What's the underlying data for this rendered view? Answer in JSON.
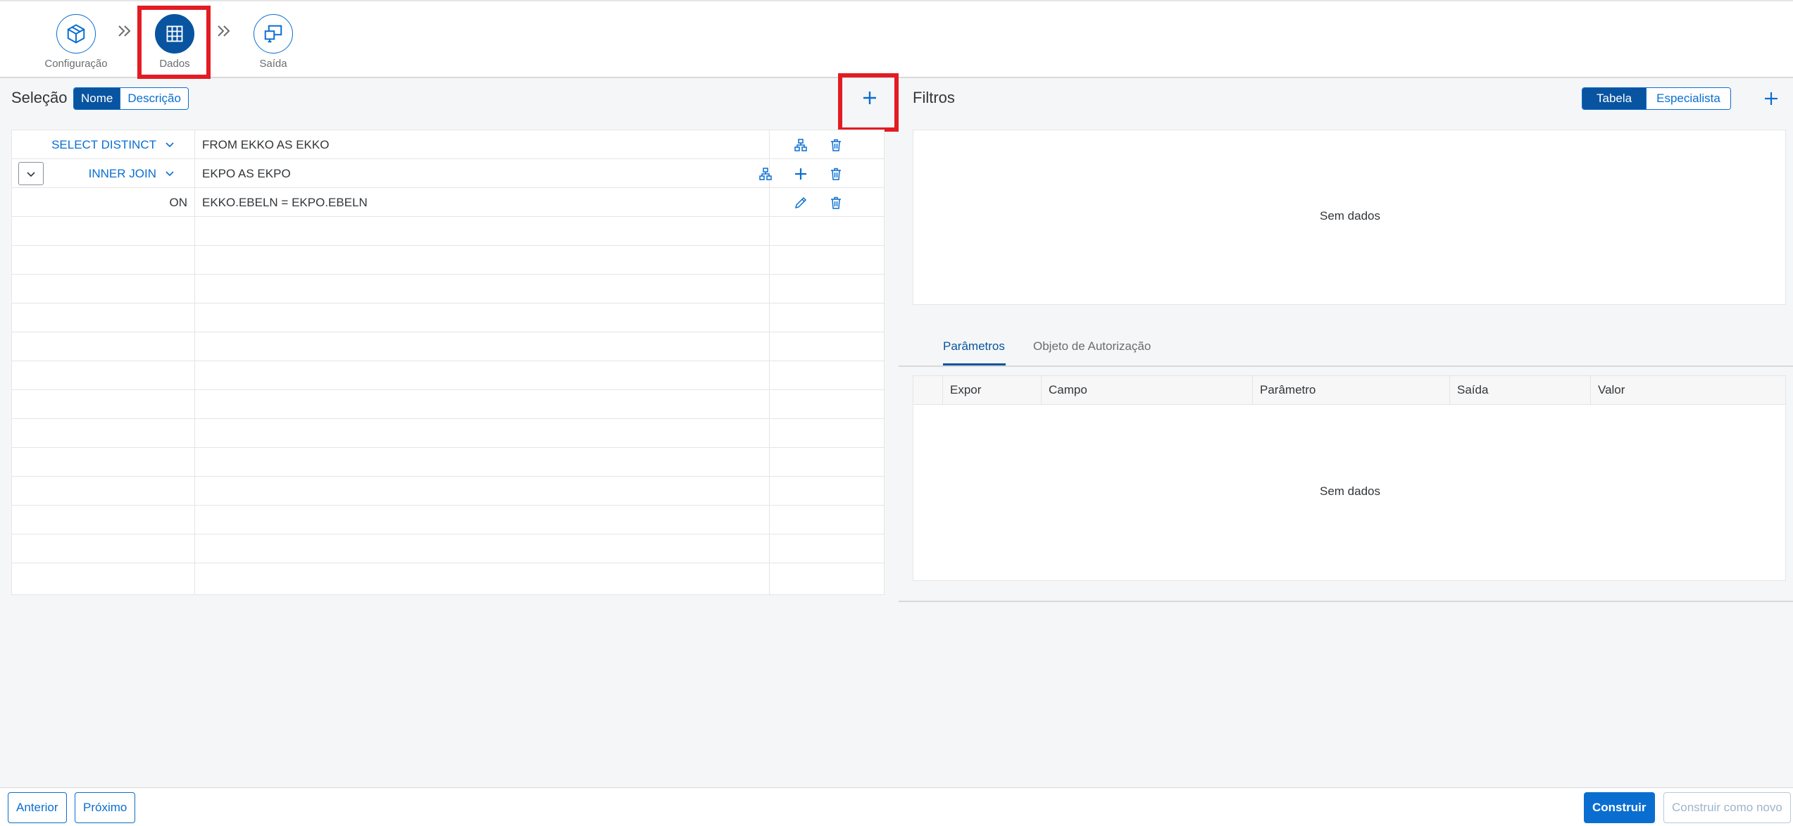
{
  "wizard": {
    "steps": [
      {
        "label": "Configuração",
        "icon": "package-icon"
      },
      {
        "label": "Dados",
        "icon": "table-grid-icon"
      },
      {
        "label": "Saída",
        "icon": "screens-icon"
      }
    ]
  },
  "selection": {
    "title": "Seleção",
    "toggle": [
      "Nome",
      "Descrição"
    ],
    "rows": [
      {
        "keyword": "SELECT DISTINCT",
        "value": "FROM EKKO AS EKKO"
      },
      {
        "keyword": "INNER JOIN",
        "value": "EKPO AS EKPO"
      },
      {
        "keyword": "ON",
        "value": "EKKO.EBELN = EKPO.EBELN"
      }
    ]
  },
  "filters": {
    "title": "Filtros",
    "toggle": [
      "Tabela",
      "Especialista"
    ],
    "no_data": "Sem dados"
  },
  "params": {
    "tabs": [
      "Parâmetros",
      "Objeto de Autorização"
    ],
    "columns": [
      "Expor",
      "Campo",
      "Parâmetro",
      "Saída",
      "Valor"
    ],
    "no_data": "Sem dados"
  },
  "footer": {
    "prev": "Anterior",
    "next": "Próximo",
    "build": "Construir",
    "build_new": "Construir como novo"
  },
  "colors": {
    "accent": "#0a6ed1",
    "accent_dark": "#0854a0",
    "highlight": "#e31b23"
  }
}
